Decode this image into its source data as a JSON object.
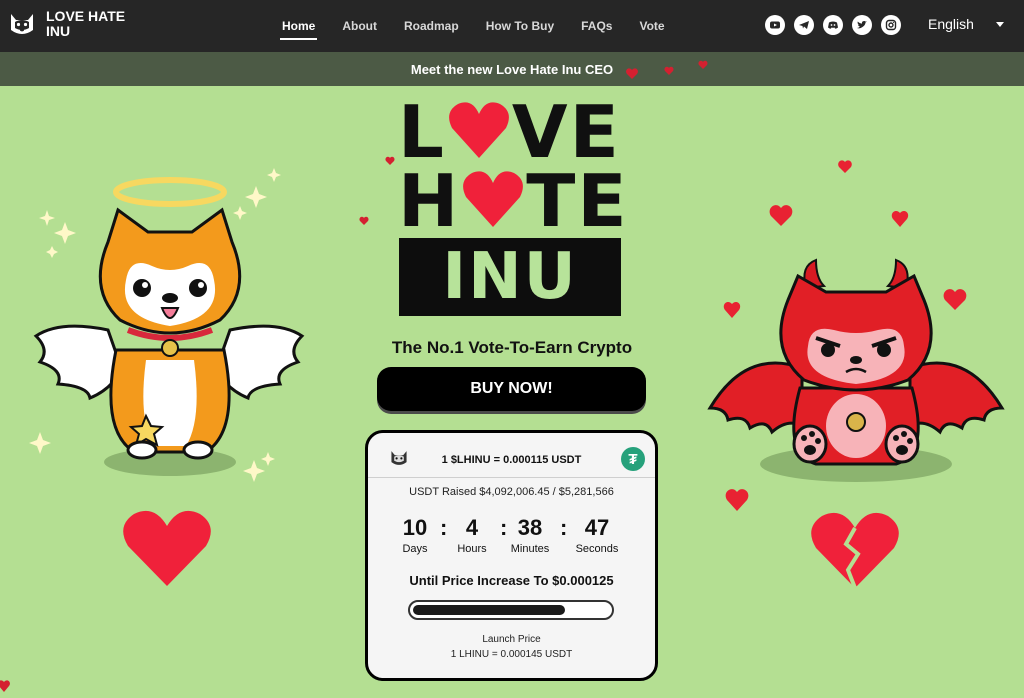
{
  "brand": {
    "name": "LOVE HATE INU"
  },
  "nav": {
    "links": [
      {
        "label": "Home",
        "active": true
      },
      {
        "label": "About",
        "active": false
      },
      {
        "label": "Roadmap",
        "active": false
      },
      {
        "label": "How To Buy",
        "active": false
      },
      {
        "label": "FAQs",
        "active": false
      },
      {
        "label": "Vote",
        "active": false
      }
    ],
    "socials": [
      "youtube-icon",
      "telegram-icon",
      "discord-icon",
      "twitter-icon",
      "instagram-icon"
    ],
    "language": "English"
  },
  "announcement": "Meet the new Love Hate Inu CEO",
  "hero": {
    "title_line1": [
      "L",
      "V",
      "E"
    ],
    "title_line2": [
      "H",
      "TE"
    ],
    "title_line3": "INU",
    "tagline": "The No.1 Vote-To-Earn Crypto",
    "buy_label": "BUY NOW!"
  },
  "presale": {
    "rate": "1 $LHINU = 0.000115 USDT",
    "raised": "USDT Raised $4,092,006.45 / $5,281,566",
    "raised_fraction": 0.775,
    "countdown": [
      {
        "value": "10",
        "label": "Days"
      },
      {
        "value": "4",
        "label": "Hours"
      },
      {
        "value": "38",
        "label": "Minutes"
      },
      {
        "value": "47",
        "label": "Seconds"
      }
    ],
    "until_text": "Until Price Increase To $0.000125",
    "launch_label": "Launch Price",
    "launch_value": "1 LHINU = 0.000145 USDT"
  },
  "colors": {
    "background": "#b4df92",
    "navbar": "#262626",
    "announcement": "#4c5a45",
    "heart": "#f0213a",
    "inu_text": "#b7e39a",
    "usdt": "#26a17b"
  }
}
